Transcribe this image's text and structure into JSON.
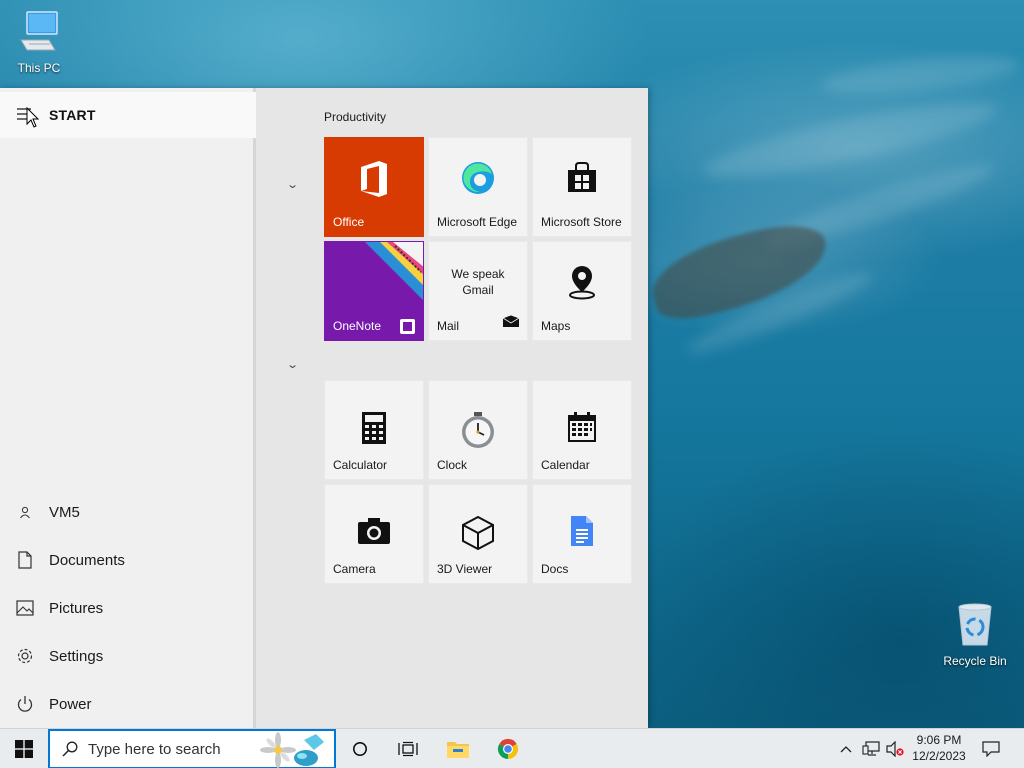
{
  "desktop": {
    "icons": [
      {
        "label": "This PC",
        "icon": "this-pc-icon"
      },
      {
        "label": "Recycle Bin",
        "icon": "recycle-bin-icon"
      }
    ]
  },
  "start_menu": {
    "title": "START",
    "left_items": [
      {
        "label": "VM5",
        "icon": "user-icon"
      },
      {
        "label": "Documents",
        "icon": "document-icon"
      },
      {
        "label": "Pictures",
        "icon": "pictures-icon"
      },
      {
        "label": "Settings",
        "icon": "gear-icon"
      },
      {
        "label": "Power",
        "icon": "power-icon"
      }
    ],
    "group_title": "Productivity",
    "tiles_group1": [
      {
        "label": "Office",
        "icon": "office-icon",
        "color": "#d83b01"
      },
      {
        "label": "Microsoft Edge",
        "icon": "edge-icon"
      },
      {
        "label": "Microsoft Store",
        "icon": "store-icon"
      },
      {
        "label": "OneNote",
        "icon": "onenote-icon",
        "color": "#7719aa"
      },
      {
        "label": "Mail",
        "icon": "mail-icon",
        "promo": "We speak Gmail"
      },
      {
        "label": "Maps",
        "icon": "maps-icon"
      }
    ],
    "tiles_group2": [
      {
        "label": "Calculator",
        "icon": "calculator-icon"
      },
      {
        "label": "Clock",
        "icon": "clock-icon"
      },
      {
        "label": "Calendar",
        "icon": "calendar-icon"
      },
      {
        "label": "Camera",
        "icon": "camera-icon"
      },
      {
        "label": "3D Viewer",
        "icon": "3d-viewer-icon"
      },
      {
        "label": "Docs",
        "icon": "docs-icon"
      }
    ]
  },
  "taskbar": {
    "search_placeholder": "Type here to search",
    "pinned": [
      "file-explorer-icon",
      "chrome-icon"
    ],
    "time": "9:06 PM",
    "date": "12/2/2023",
    "accent": "#0078d7"
  }
}
